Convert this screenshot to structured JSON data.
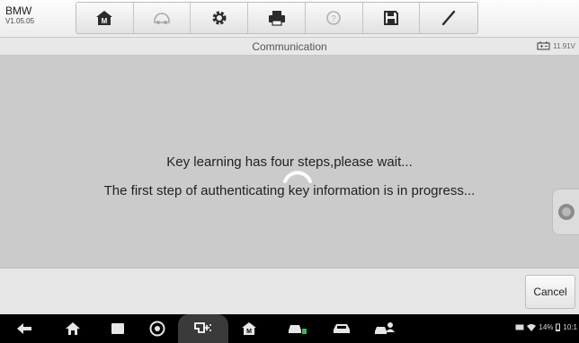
{
  "vehicle": {
    "make": "BMW",
    "version": "V1.05.05"
  },
  "toolbar": {
    "buttons": [
      {
        "icon": "home-icon"
      },
      {
        "icon": "vehicle-swap-icon"
      },
      {
        "icon": "settings-icon"
      },
      {
        "icon": "print-icon"
      },
      {
        "icon": "help-icon"
      },
      {
        "icon": "save-icon"
      },
      {
        "icon": "pen-icon"
      }
    ]
  },
  "titlebar": {
    "title": "Communication",
    "voltage": "11.91V"
  },
  "main": {
    "message_1": "Key learning has four steps,please wait...",
    "message_2": "The first step of authenticating key information is in progress..."
  },
  "actions": {
    "cancel_label": "Cancel"
  },
  "status": {
    "battery_pct": "14%",
    "time": "10:1"
  }
}
